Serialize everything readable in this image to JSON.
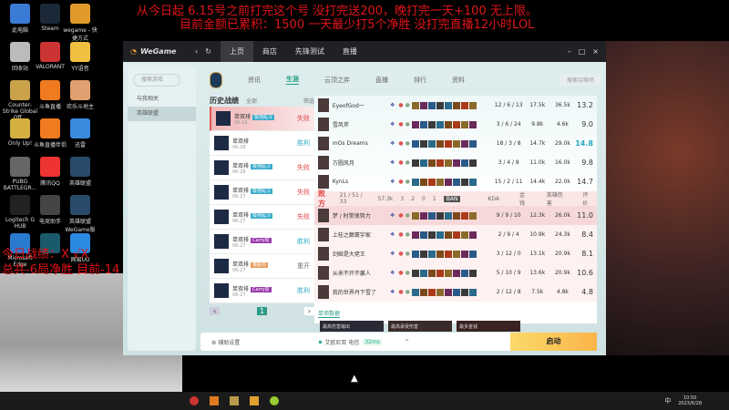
{
  "overlay": {
    "line1": "从今日起 6.15号之前打完这个号 没打完送200，晚打完一天+100 无上限。",
    "line2": "目前金额已累积：1500    一天最少打5个净胜 没打完直播12小时LOL",
    "stat1": "今日战绩：X  √X",
    "stat2": "总共-6局净胜  目前-14"
  },
  "desktop": [
    "此电脑",
    "Steam",
    "wegame - 快捷方式",
    "回收站",
    "VALORANT",
    "YY语音",
    "Counter-Strike Global Off...",
    "斗鱼直播",
    "欢乐斗地主",
    "Only Up!",
    "斗鱼直播伴侣",
    "迅雷",
    "PUBG BATTLEGR...",
    "腾讯QQ",
    "英雄联盟",
    "Logitech G HUB",
    "电竞助手",
    "英雄联盟 WeGame版",
    "Microsoft Edge",
    "",
    "网易UU"
  ],
  "titlebar": {
    "logo": "WeGame",
    "tabs": [
      "上页",
      "商店",
      "先锋测试",
      "直播"
    ]
  },
  "sidebar": {
    "search": "搜索游戏",
    "items": [
      "与我相关",
      "英雄联盟"
    ]
  },
  "nav": [
    "资讯",
    "生涯",
    "云顶之弈",
    "直播",
    "排行",
    "资料"
  ],
  "nav_search": "搜索召唤师",
  "history": {
    "title": "历史战绩",
    "mode": "全部",
    "filter": "筛选",
    "page": "1",
    "rows": [
      {
        "mode": "单双排",
        "tag": "极地乱斗",
        "date": "06-28",
        "result": "失败"
      },
      {
        "mode": "单双排",
        "tag": "",
        "date": "06-28",
        "result": "胜利"
      },
      {
        "mode": "单双排",
        "tag": "极地乱斗",
        "date": "06-28",
        "result": "失败"
      },
      {
        "mode": "单双排",
        "tag": "极地乱斗",
        "date": "06-27",
        "result": "失败"
      },
      {
        "mode": "单双排",
        "tag": "极地乱斗",
        "date": "06-27",
        "result": "失败"
      },
      {
        "mode": "单双排",
        "tag": "Carry局",
        "date": "06-27",
        "result": "胜利"
      },
      {
        "mode": "单双排",
        "tag": "偏差局",
        "date": "06-27",
        "result": "重开"
      },
      {
        "mode": "单双排",
        "tag": "Carry局",
        "date": "06-27",
        "result": "胜利"
      }
    ]
  },
  "team1": [
    {
      "name": "EyeofGod一",
      "kda": "12 / 6 / 13",
      "dmg": "17.5k",
      "gold": "36.5k",
      "score": "13.2"
    },
    {
      "name": "雪风斧",
      "kda": "3 / 6 / 24",
      "dmg": "9.8k",
      "gold": "4.6k",
      "score": "9.0"
    },
    {
      "name": "mOs Dreams",
      "kda": "18 / 3 / 8",
      "dmg": "14.7k",
      "gold": "29.0k",
      "score": "14.8"
    },
    {
      "name": "方圆风月",
      "kda": "3 / 4 / 8",
      "dmg": "11.0k",
      "gold": "16.0k",
      "score": "9.8"
    },
    {
      "name": "KynLs",
      "kda": "15 / 2 / 11",
      "dmg": "14.4k",
      "gold": "22.0k",
      "score": "14.7"
    }
  ],
  "lose_header": {
    "label": "败方",
    "kills": "21 / 51 / 33",
    "gold": "57.3k",
    "towers": "3",
    "dragons": "2",
    "baron": "0",
    "herald": "1",
    "ban": "BAN",
    "col_kda": "KDA",
    "col_gold": "金钱",
    "col_dmg": "英雄伤害",
    "col_score": "评价"
  },
  "team2": [
    {
      "name": "梦 / 时常很努力",
      "kda": "9 / 9 / 10",
      "dmg": "12.3k",
      "gold": "26.0k",
      "score": "11.0"
    },
    {
      "name": "上桂之巅寰宇家",
      "kda": "2 / 9 / 4",
      "dmg": "10.9k",
      "gold": "24.3k",
      "score": "8.4"
    },
    {
      "name": "剑姬是大佬王",
      "kda": "3 / 12 / 0",
      "dmg": "13.1k",
      "gold": "20.9k",
      "score": "8.1"
    },
    {
      "name": "从来不开不赢人",
      "kda": "5 / 10 / 9",
      "dmg": "13.6k",
      "gold": "20.9k",
      "score": "10.6"
    },
    {
      "name": "我的世界丹下雪了",
      "kda": "2 / 12 / 8",
      "dmg": "7.5k",
      "gold": "4.8k",
      "score": "4.8"
    }
  ],
  "single_data": "单项数据",
  "thumbs": [
    "最高伤害输出",
    "最高承受伤害",
    "最多金钱"
  ],
  "bottom": {
    "settings": "辅助设置",
    "server": "艾欧尼亚 电信",
    "ping": "32ms",
    "launch": "启动"
  },
  "taskbar": {
    "ime": "中",
    "time": "10:50",
    "date": "2023/6/28"
  }
}
